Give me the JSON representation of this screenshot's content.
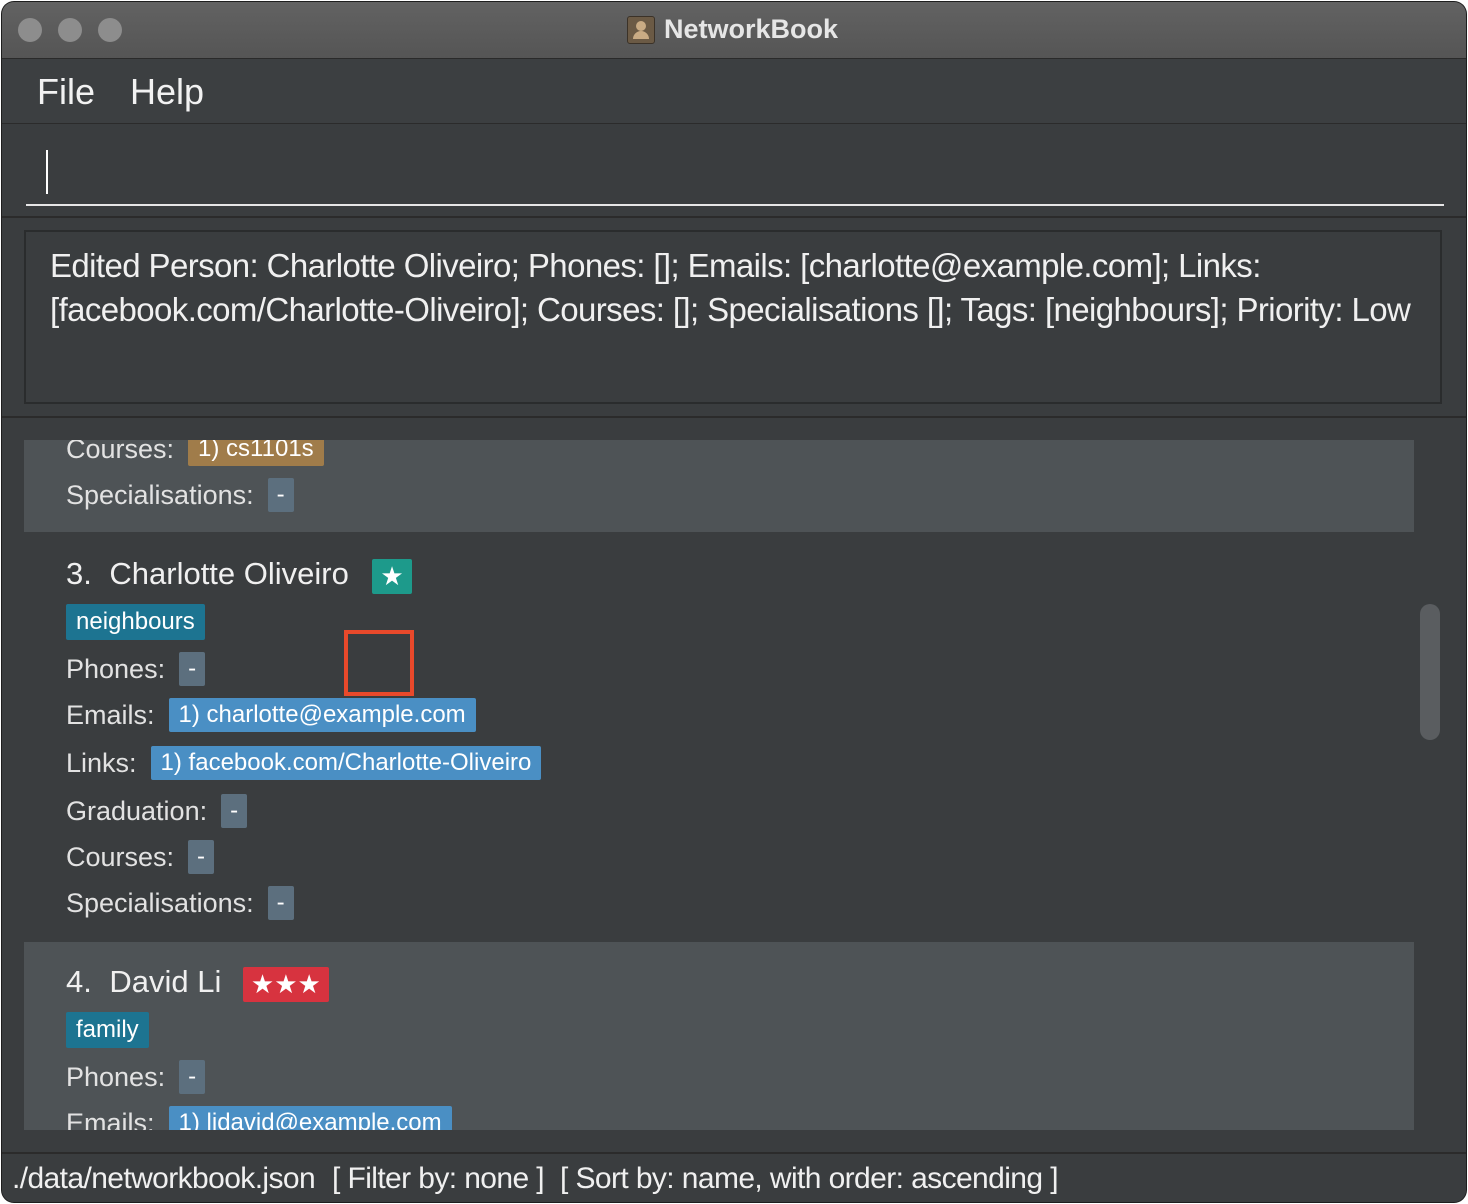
{
  "window": {
    "title": "NetworkBook",
    "title_icon": "address-book-icon"
  },
  "menu": {
    "file": "File",
    "help": "Help"
  },
  "command": {
    "value": ""
  },
  "result": {
    "text": "Edited Person: Charlotte Oliveiro; Phones: []; Emails: [charlotte@example.com]; Links: [facebook.com/Charlotte-Oliveiro]; Courses: []; Specialisations []; Tags: [neighbours]; Priority: Low"
  },
  "persons": {
    "prev": {
      "courses_label": "Courses:",
      "course_chip": "1) cs1101s",
      "specialisations_label": "Specialisations:",
      "specialisations_value": "-"
    },
    "charlotte": {
      "index": "3.",
      "name": "Charlotte Oliveiro",
      "priority": "★",
      "priority_color": "#1d9a8b",
      "tag": "neighbours",
      "phones_label": "Phones:",
      "phones_value": "-",
      "emails_label": "Emails:",
      "email": "1) charlotte@example.com",
      "links_label": "Links:",
      "link": "1) facebook.com/Charlotte-Oliveiro",
      "graduation_label": "Graduation:",
      "graduation_value": "-",
      "courses_label": "Courses:",
      "courses_value": "-",
      "specialisations_label": "Specialisations:",
      "specialisations_value": "-"
    },
    "david": {
      "index": "4.",
      "name": "David Li",
      "priority": "★★★",
      "priority_color": "#d7333f",
      "tag": "family",
      "phones_label": "Phones:",
      "phones_value": "-",
      "emails_label": "Emails:",
      "email": "1) lidavid@example.com"
    }
  },
  "status": {
    "file": "./data/networkbook.json",
    "filter": "[ Filter by: none ]",
    "sort": "[ Sort by: name, with order: ascending ]"
  }
}
